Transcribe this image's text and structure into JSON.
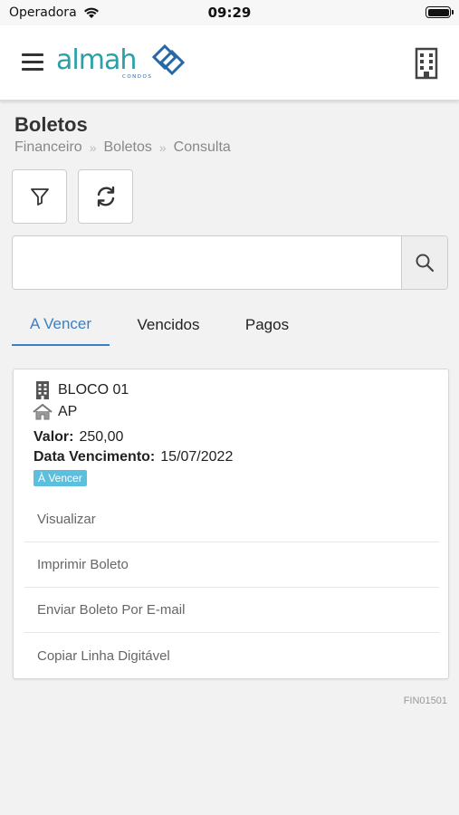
{
  "status_bar": {
    "carrier": "Operadora",
    "time": "09:29"
  },
  "header": {
    "logo_text": "almah",
    "logo_subtext": "CONDOS",
    "brand_color": "#2aa0a8",
    "brand_accent": "#2468a8"
  },
  "page": {
    "title": "Boletos",
    "breadcrumb": [
      "Financeiro",
      "Boletos",
      "Consulta"
    ]
  },
  "search": {
    "value": "",
    "placeholder": ""
  },
  "tabs": [
    {
      "label": "A Vencer",
      "active": true
    },
    {
      "label": "Vencidos",
      "active": false
    },
    {
      "label": "Pagos",
      "active": false
    }
  ],
  "boleto": {
    "block": "BLOCO 01",
    "unit": "AP",
    "value_label": "Valor:",
    "value": "250,00",
    "due_label": "Data Vencimento:",
    "due_date": "15/07/2022",
    "status": "À Vencer",
    "status_color": "#5bc0de",
    "actions": [
      "Visualizar",
      "Imprimir Boleto",
      "Enviar Boleto Por E-mail",
      "Copiar Linha Digitável"
    ]
  },
  "screen_code": "FIN01501",
  "icons": {
    "menu": "hamburger-icon",
    "building": "building-icon",
    "filter": "filter-icon",
    "refresh": "refresh-icon",
    "search": "search-icon",
    "block": "building-icon",
    "unit": "home-icon"
  }
}
